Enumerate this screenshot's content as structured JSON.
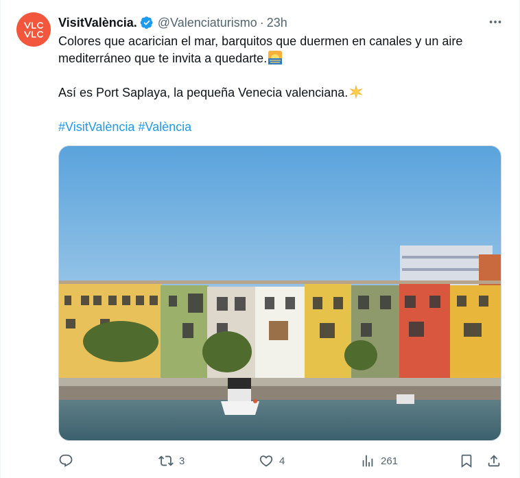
{
  "tweet": {
    "author_name": "VisitValència.",
    "handle": "@Valenciaturismo",
    "separator": "·",
    "time": "23h",
    "avatar_text": "VLC",
    "line1": "Colores que acarician el mar, barquitos que duermen en canales y un aire mediterráneo que te invita a quedarte.",
    "line2": "Así es Port Saplaya, la pequeña Venecia valenciana.",
    "hashtags": "#VisitValència #València",
    "emoji1": "sunrise-over-sea-icon",
    "emoji2": "glowing-star-icon",
    "image": "photo of colorful houses along a canal with a small boat"
  },
  "actions": {
    "reply": {
      "icon": "reply-icon",
      "count": ""
    },
    "retweet": {
      "icon": "retweet-icon",
      "count": "3"
    },
    "like": {
      "icon": "heart-icon",
      "count": "4"
    },
    "views": {
      "icon": "views-icon",
      "count": "261"
    },
    "bookmark": {
      "icon": "bookmark-icon"
    },
    "share": {
      "icon": "share-icon"
    }
  },
  "colors": {
    "avatar": "#f2563d",
    "verified": "#1d9bf0",
    "link": "#1d9bf0",
    "muted": "#536471"
  }
}
